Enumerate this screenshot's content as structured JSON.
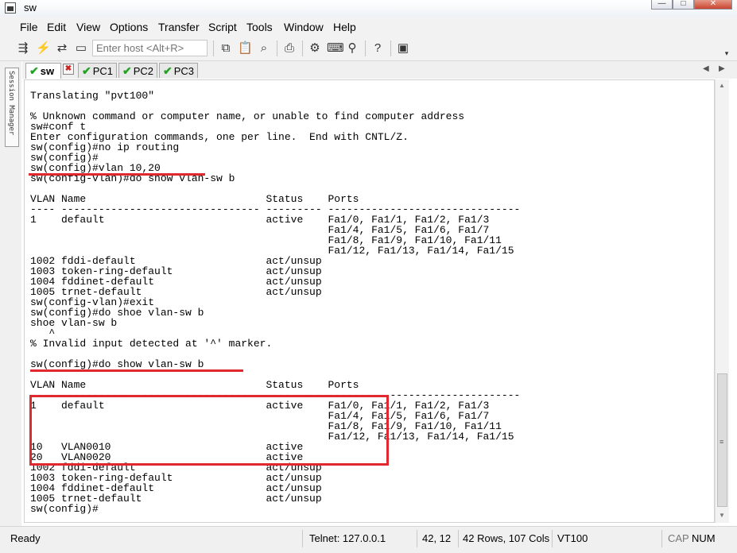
{
  "window": {
    "title": "sw",
    "controls": [
      "—",
      "□",
      "✕"
    ]
  },
  "menu": [
    "File",
    "Edit",
    "View",
    "Options",
    "Transfer",
    "Script",
    "Tools",
    "Window",
    "Help"
  ],
  "toolbar": {
    "host_placeholder": "Enter host <Alt+R>"
  },
  "session_manager": {
    "label": "Session Manager"
  },
  "tabs": [
    {
      "label": "sw",
      "status": "connected",
      "active": true
    },
    {
      "label": "PC1",
      "status": "connected",
      "active": false
    },
    {
      "label": "PC2",
      "status": "connected",
      "active": false
    },
    {
      "label": "PC3",
      "status": "connected",
      "active": false
    }
  ],
  "terminal": {
    "lines": [
      "Translating \"pvt100\"",
      "",
      "% Unknown command or computer name, or unable to find computer address",
      "sw#conf t",
      "Enter configuration commands, one per line.  End with CNTL/Z.",
      "sw(config)#no ip routing",
      "sw(config)#",
      "sw(config)#vlan 10,20",
      "sw(config-vlan)#do show vlan-sw b",
      "",
      "VLAN Name                             Status    Ports",
      "---- -------------------------------- --------- -------------------------------",
      "1    default                          active    Fa1/0, Fa1/1, Fa1/2, Fa1/3",
      "                                                Fa1/4, Fa1/5, Fa1/6, Fa1/7",
      "                                                Fa1/8, Fa1/9, Fa1/10, Fa1/11",
      "                                                Fa1/12, Fa1/13, Fa1/14, Fa1/15",
      "1002 fddi-default                     act/unsup",
      "1003 token-ring-default               act/unsup",
      "1004 fddinet-default                  act/unsup",
      "1005 trnet-default                    act/unsup",
      "sw(config-vlan)#exit",
      "sw(config)#do shoe vlan-sw b",
      "shoe vlan-sw b",
      "   ^",
      "% Invalid input detected at '^' marker.",
      "",
      "sw(config)#do show vlan-sw b",
      "",
      "VLAN Name                             Status    Ports",
      "---- -------------------------------- --------- -------------------------------",
      "1    default                          active    Fa1/0, Fa1/1, Fa1/2, Fa1/3",
      "                                                Fa1/4, Fa1/5, Fa1/6, Fa1/7",
      "                                                Fa1/8, Fa1/9, Fa1/10, Fa1/11",
      "                                                Fa1/12, Fa1/13, Fa1/14, Fa1/15",
      "10   VLAN0010                         active",
      "20   VLAN0020                         active",
      "1002 fddi-default                     act/unsup",
      "1003 token-ring-default               act/unsup",
      "1004 fddinet-default                  act/unsup",
      "1005 trnet-default                    act/unsup",
      "sw(config)#"
    ]
  },
  "status": {
    "ready": "Ready",
    "connection": "Telnet: 127.0.0.1",
    "cursor": "42,  12",
    "size": "42 Rows, 107 Cols",
    "emulation": "VT100",
    "cap": "CAP",
    "num": "NUM"
  },
  "colors": {
    "annotation": "#e0282e",
    "tab_check": "#22a322"
  }
}
